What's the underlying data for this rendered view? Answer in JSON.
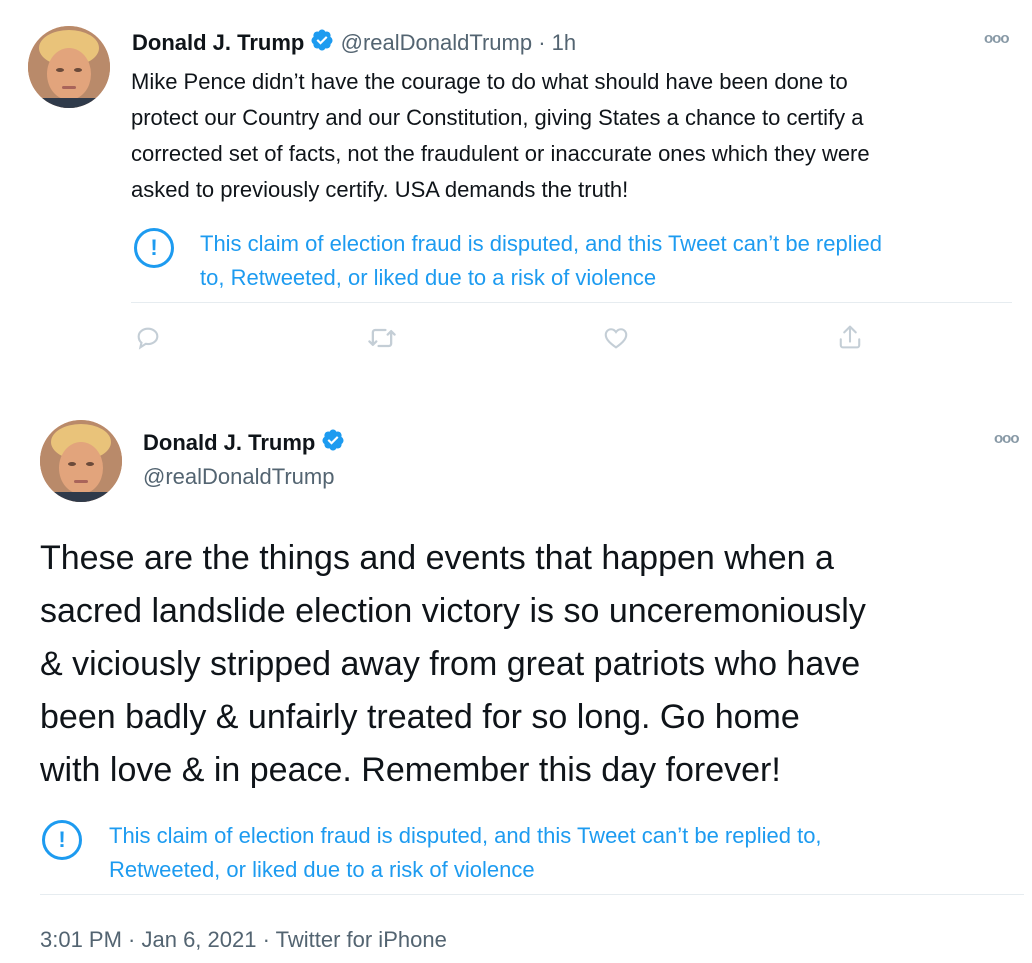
{
  "tweet1": {
    "name": "Donald J. Trump",
    "handle": "@realDonaldTrump",
    "time": "· 1h",
    "text_lines": [
      "Mike Pence didn’t have the courage to do what should have been done to",
      "protect our Country and our Constitution, giving States a chance to certify a",
      "corrected set of facts, not the fraudulent or inaccurate ones which they were",
      "asked to previously certify. USA demands the truth!"
    ],
    "notice_lines": [
      "This claim of election fraud is disputed, and this Tweet can’t be replied",
      "to, Retweeted, or liked due to a risk of violence"
    ],
    "more_icon": "ooo",
    "notice_icon": "!",
    "actions": [
      "reply-icon",
      "retweet-icon",
      "like-icon",
      "share-icon"
    ]
  },
  "tweet2": {
    "name": "Donald J. Trump",
    "handle": "@realDonaldTrump",
    "more_icon": "ooo",
    "text_lines": [
      "These are the things and events that happen when a",
      "sacred landslide election victory is so unceremoniously",
      "& viciously stripped away from great patriots who have",
      "been badly & unfairly treated for so long. Go home",
      "with love & in peace. Remember this day forever!"
    ],
    "notice_lines": [
      "This claim of election fraud is disputed, and this Tweet can’t be replied to,",
      "Retweeted, or liked due to a risk of violence"
    ],
    "notice_icon": "!",
    "meta": "3:01 PM · Jan 6, 2021 · Twitter for iPhone"
  },
  "colors": {
    "accent": "#1d9bf0",
    "text": "#0f1419",
    "secondary": "#536471",
    "verified": "#1d9bf0"
  }
}
